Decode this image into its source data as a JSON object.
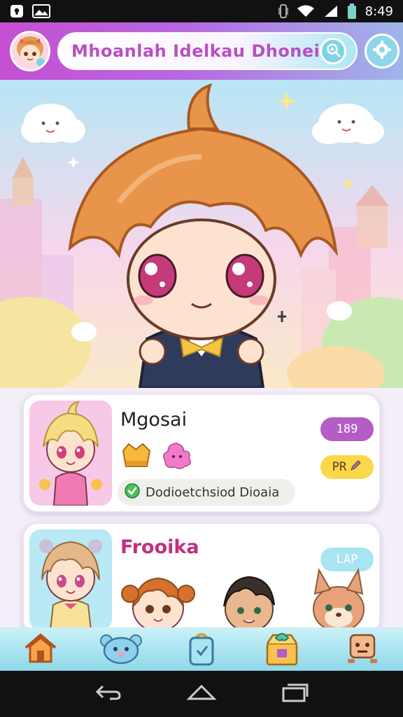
{
  "status_bar": {
    "time": "8:49",
    "icons": [
      "notification-icon",
      "photo-icon",
      "vibrate-icon",
      "wifi-icon",
      "signal-icon",
      "battery-icon"
    ]
  },
  "header": {
    "title": "Mhoanlah Idelkau Dhonei",
    "search_icon": "search-icon",
    "settings_icon": "settings-icon"
  },
  "cards": [
    {
      "title": "Mgosai",
      "tag_primary": "189",
      "tag_secondary": "PR",
      "status_text": "Dodioetchsiod Dioaia",
      "status_icon": "check-icon",
      "badges": [
        "crown-badge-icon",
        "pink-blob-badge-icon"
      ]
    },
    {
      "title": "Frooika",
      "tag_primary": "LAP"
    }
  ],
  "bottom_nav": {
    "items": [
      "home-icon",
      "pet-icon",
      "bag-icon",
      "gift-box-icon",
      "robot-icon"
    ]
  },
  "system_nav": {
    "items": [
      "back-icon",
      "home-nav-icon",
      "recents-icon"
    ]
  },
  "colors": {
    "header_accent": "#c54fd3",
    "title_text": "#b84fc1",
    "card_title_2": "#c0307f",
    "tag_purple": "#b65cc6",
    "tag_yellow": "#fbd74a",
    "tag_cyan": "#a9e4f1",
    "nav_bg": "#8fd8e8"
  }
}
